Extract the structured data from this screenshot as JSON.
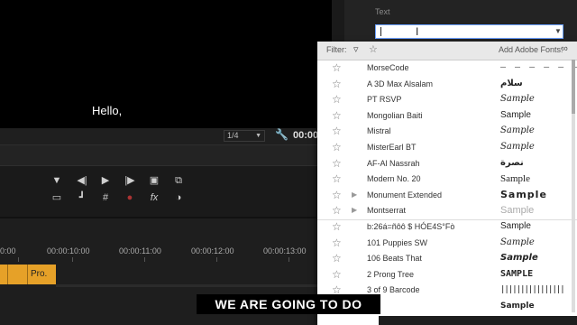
{
  "program_monitor": {
    "caption": "Hello,"
  },
  "monitor_controls": {
    "zoom": "1/4",
    "timecode": "00:00"
  },
  "essential_graphics": {
    "text_label": "Text"
  },
  "font_dropdown": {
    "filter_label": "Filter:",
    "add_fonts_label": "Add Adobe Fonts:",
    "fonts": [
      {
        "name": "MorseCode",
        "sample": "– – – – – –",
        "style": "mono"
      },
      {
        "name": "A 3D Max Alsalam",
        "sample": "سلام",
        "style": "arabic"
      },
      {
        "name": "PT RSVP",
        "sample": "Sample",
        "style": "script"
      },
      {
        "name": "Mongolian Baiti",
        "sample": "Sample",
        "style": "sans"
      },
      {
        "name": "Mistral",
        "sample": "Sample",
        "style": "script"
      },
      {
        "name": "MisterEarl BT",
        "sample": "Sample",
        "style": "script"
      },
      {
        "name": "AF-Al Nassrah",
        "sample": "ﻧﺼﺮة",
        "style": "arabic"
      },
      {
        "name": "Modern No. 20",
        "sample": "Sample",
        "style": "serif"
      },
      {
        "name": "Monument Extended",
        "sample": "Sample",
        "style": "wide",
        "expandable": true
      },
      {
        "name": "Montserrat",
        "sample": "Sample",
        "style": "light",
        "expandable": true
      },
      {
        "name": "b:26á=ñôô     $     HÓE4S°Fò",
        "sample": "Sample",
        "style": "sans"
      },
      {
        "name": "101 Puppies SW",
        "sample": "Sample",
        "style": "script"
      },
      {
        "name": "106 Beats That",
        "sample": "Sample",
        "style": "bold-italic"
      },
      {
        "name": "2 Prong Tree",
        "sample": "SAMPLE",
        "style": "caps"
      },
      {
        "name": "3 of 9 Barcode",
        "sample": "||||||||||||||||",
        "style": "barcode"
      },
      {
        "name": "",
        "sample": "Sample",
        "style": "bold"
      }
    ]
  },
  "timeline": {
    "timecodes": [
      "0:00",
      "00:00:10:00",
      "00:00:11:00",
      "00:00:12:00",
      "00:00:13:00"
    ],
    "clip_label": "Pro."
  },
  "subtitle": "WE ARE GOING TO DO"
}
